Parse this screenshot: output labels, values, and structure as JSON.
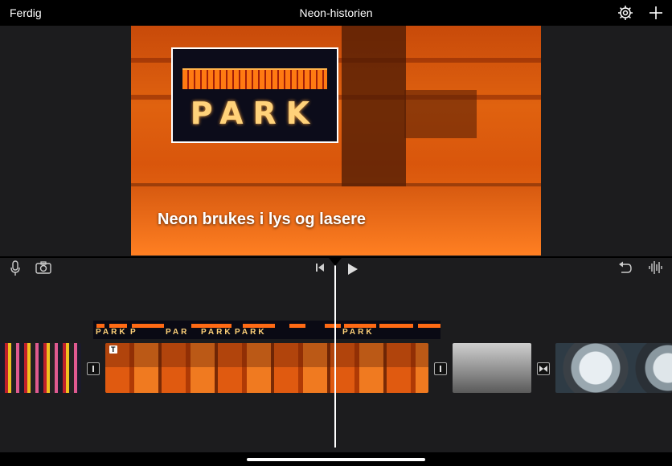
{
  "topbar": {
    "done_label": "Ferdig",
    "title": "Neon-historien",
    "settings_icon": "gear-icon",
    "add_icon": "plus-icon"
  },
  "viewer": {
    "caption": "Neon brukes i lys og lasere",
    "pip_text": "PARK"
  },
  "toolbar": {
    "left_icons": [
      "microphone-icon",
      "camera-icon"
    ],
    "center_icons": [
      "skip-to-start-icon",
      "play-icon"
    ],
    "right_icons": [
      "undo-icon",
      "audio-waveform-icon"
    ]
  },
  "timeline": {
    "overlay_labels": [
      "PARK",
      "P",
      "PAR",
      "PARK",
      "PARK",
      "PARK"
    ],
    "clips": [
      "city-neon-clip",
      "orange-machine-clip",
      "lab-machine-clip",
      "round-window-clip"
    ],
    "title_badge": "T"
  },
  "colors": {
    "accent_orange": "#f07418",
    "background": "#1c1c1e"
  }
}
